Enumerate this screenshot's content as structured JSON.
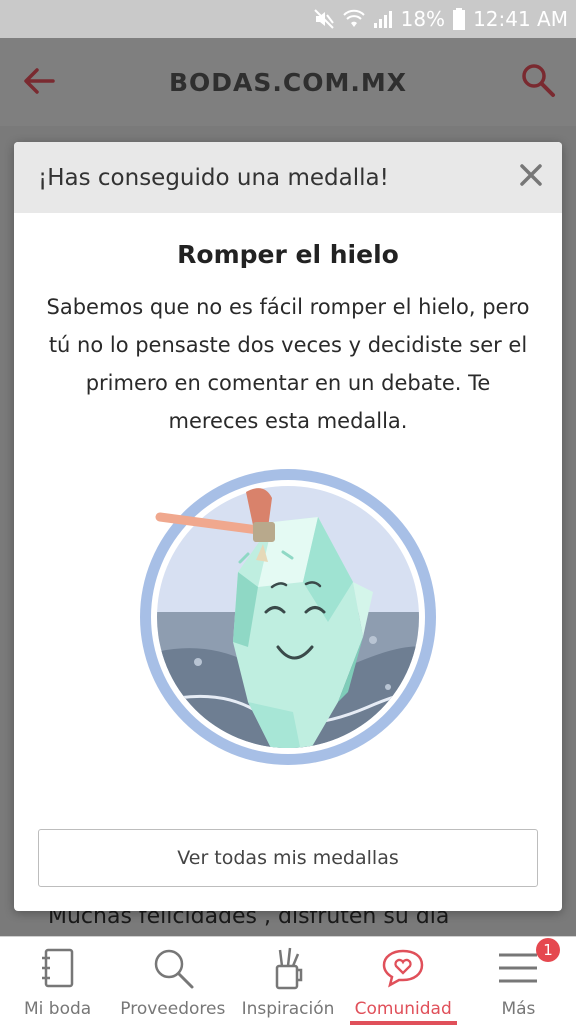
{
  "status_bar": {
    "battery": "18%",
    "time": "12:41 AM"
  },
  "header": {
    "title": "BODAS.COM.MX"
  },
  "background": {
    "comment_text": "Muchas felicidades , disfruten su dia"
  },
  "modal": {
    "header_title": "¡Has conseguido una medalla!",
    "medal_title": "Romper el hielo",
    "medal_description": "Sabemos que no es fácil romper el hielo, pero tú no lo pensaste dos veces y decidiste ser el primero en comentar en un debate. Te mereces esta medalla.",
    "button_label": "Ver todas mis medallas"
  },
  "bottom_nav": {
    "items": [
      {
        "label": "Mi boda",
        "icon": "notebook-icon"
      },
      {
        "label": "Proveedores",
        "icon": "search-icon"
      },
      {
        "label": "Inspiración",
        "icon": "pencil-cup-icon"
      },
      {
        "label": "Comunidad",
        "icon": "chat-heart-icon",
        "active": true
      },
      {
        "label": "Más",
        "icon": "menu-icon",
        "badge": "1"
      }
    ]
  },
  "colors": {
    "accent": "#e0505a",
    "badge": "#e5484f"
  }
}
